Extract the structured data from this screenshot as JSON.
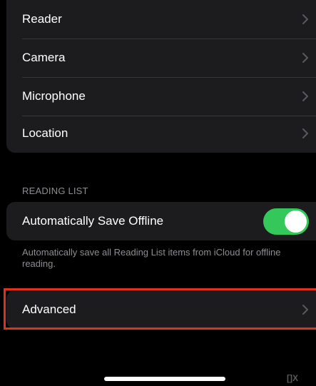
{
  "permissions": {
    "items": [
      {
        "label": "Reader"
      },
      {
        "label": "Camera"
      },
      {
        "label": "Microphone"
      },
      {
        "label": "Location"
      }
    ]
  },
  "reading_list": {
    "header": "READING LIST",
    "save_offline": {
      "label": "Automatically Save Offline",
      "enabled": true
    },
    "footer": "Automatically save all Reading List items from iCloud for offline reading."
  },
  "advanced": {
    "label": "Advanced"
  },
  "watermark": "[]X",
  "colors": {
    "background": "#000000",
    "cell": "#1c1c1e",
    "separator": "#38383a",
    "secondary_text": "#8d8d93",
    "toggle_on": "#34c759",
    "chevron": "#5a5a5e",
    "highlight": "#e0301e"
  }
}
